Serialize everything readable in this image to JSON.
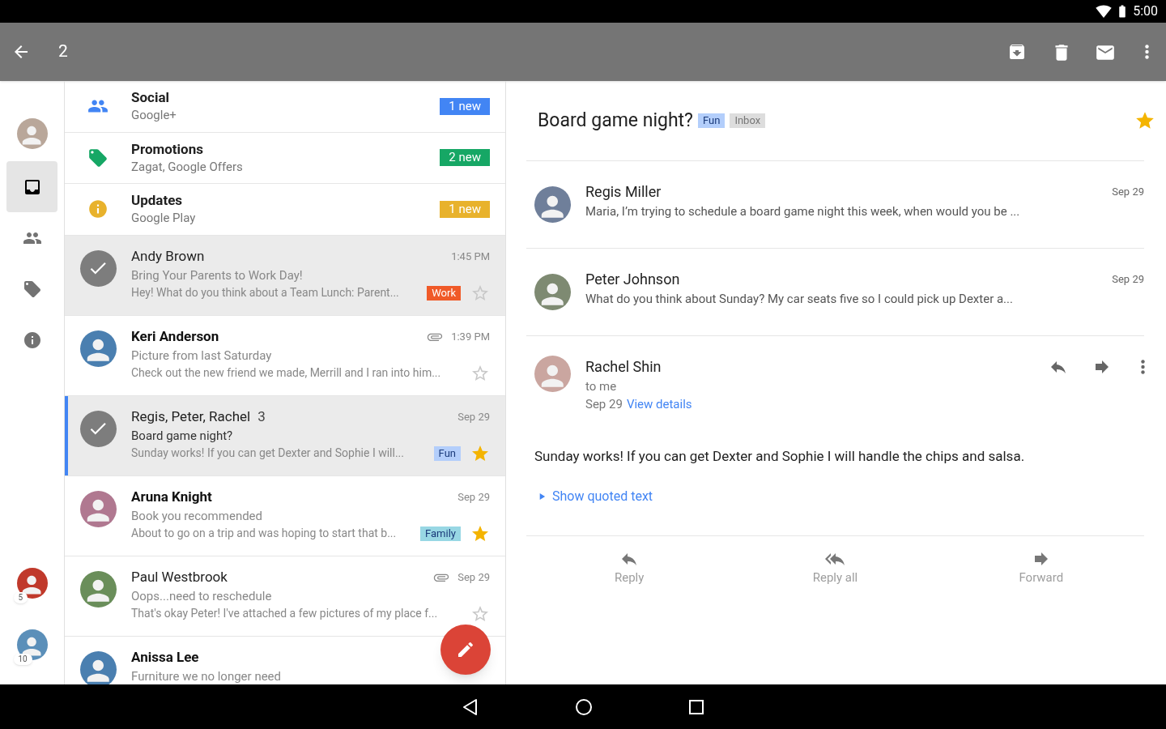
{
  "status_bar": {
    "time": "5:00"
  },
  "toolbar": {
    "selected_count": "2"
  },
  "sidebar": {
    "items": [
      {
        "kind": "inbox",
        "selected": true
      },
      {
        "kind": "people",
        "selected": false
      },
      {
        "kind": "labels",
        "selected": false
      },
      {
        "kind": "info",
        "selected": false
      }
    ],
    "accounts": [
      {
        "count": "5"
      },
      {
        "count": "10"
      }
    ]
  },
  "categories": [
    {
      "kind": "social",
      "title": "Social",
      "subtitle": "Google+",
      "badge": "1 new",
      "color": "#4285f4"
    },
    {
      "kind": "promotions",
      "title": "Promotions",
      "subtitle": "Zagat, Google Offers",
      "badge": "2 new",
      "color": "#16a765"
    },
    {
      "kind": "updates",
      "title": "Updates",
      "subtitle": "Google Play",
      "badge": "1 new",
      "color": "#e8b22c"
    }
  ],
  "emails": [
    {
      "sender": "Andy Brown",
      "unread": false,
      "checked": true,
      "open": false,
      "subject": "Bring Your Parents to Work Day!",
      "snippet": "Hey! What do you think about a Team Lunch: Parent...",
      "time": "1:45 PM",
      "attachment": false,
      "label": {
        "text": "Work",
        "color": "#f05a28"
      },
      "starred": false
    },
    {
      "sender": "Keri Anderson",
      "unread": true,
      "checked": false,
      "open": false,
      "subject": "Picture from last Saturday",
      "snippet": "Check out the new friend we made, Merrill and I ran into him...",
      "time": "1:39 PM",
      "attachment": true,
      "starred": false
    },
    {
      "sender": "Regis, Peter, Rachel",
      "count": "3",
      "unread": false,
      "checked": true,
      "open": true,
      "subject": "Board game night?",
      "snippet": "Sunday works! If you can get Dexter and Sophie I will...",
      "time": "Sep 29",
      "attachment": false,
      "label": {
        "text": "Fun",
        "color": "#b3cefb"
      },
      "starred": true
    },
    {
      "sender": "Aruna Knight",
      "unread": true,
      "checked": false,
      "open": false,
      "subject": "Book you recommended",
      "snippet": "About to go on a trip and was hoping to start that b...",
      "time": "Sep 29",
      "attachment": false,
      "label": {
        "text": "Family",
        "color": "#98d7e4"
      },
      "starred": true
    },
    {
      "sender": "Paul Westbrook",
      "unread": false,
      "checked": false,
      "open": false,
      "subject": "Oops...need to reschedule",
      "snippet": "That's okay Peter! I've attached a few pictures of my place f...",
      "time": "Sep 29",
      "attachment": true,
      "starred": false
    },
    {
      "sender": "Anissa Lee",
      "unread": true,
      "checked": false,
      "open": false,
      "subject": "Furniture we no longer need"
    }
  ],
  "thread": {
    "title": "Board game night?",
    "labels": [
      {
        "text": "Fun",
        "color": "#b3cefb"
      },
      {
        "text": "Inbox",
        "color": "#dddddd"
      }
    ],
    "starred": true,
    "collapsed": [
      {
        "sender": "Regis Miller",
        "date": "Sep 29",
        "snippet": "Maria, I’m trying to schedule a board game night this week, when would you be ..."
      },
      {
        "sender": "Peter Johnson",
        "date": "Sep 29",
        "snippet": "What do you think about Sunday? My car seats five so I could pick up Dexter a..."
      }
    ],
    "expanded": {
      "sender": "Rachel Shin",
      "to": "to me",
      "date": "Sep 29",
      "details_link": "View details",
      "body": "Sunday works! If you can get Dexter and Sophie I will handle the chips and salsa.",
      "quoted_link": "Show quoted text"
    },
    "actions": [
      {
        "kind": "reply",
        "label": "Reply"
      },
      {
        "kind": "reply_all",
        "label": "Reply all"
      },
      {
        "kind": "forward",
        "label": "Forward"
      }
    ]
  }
}
